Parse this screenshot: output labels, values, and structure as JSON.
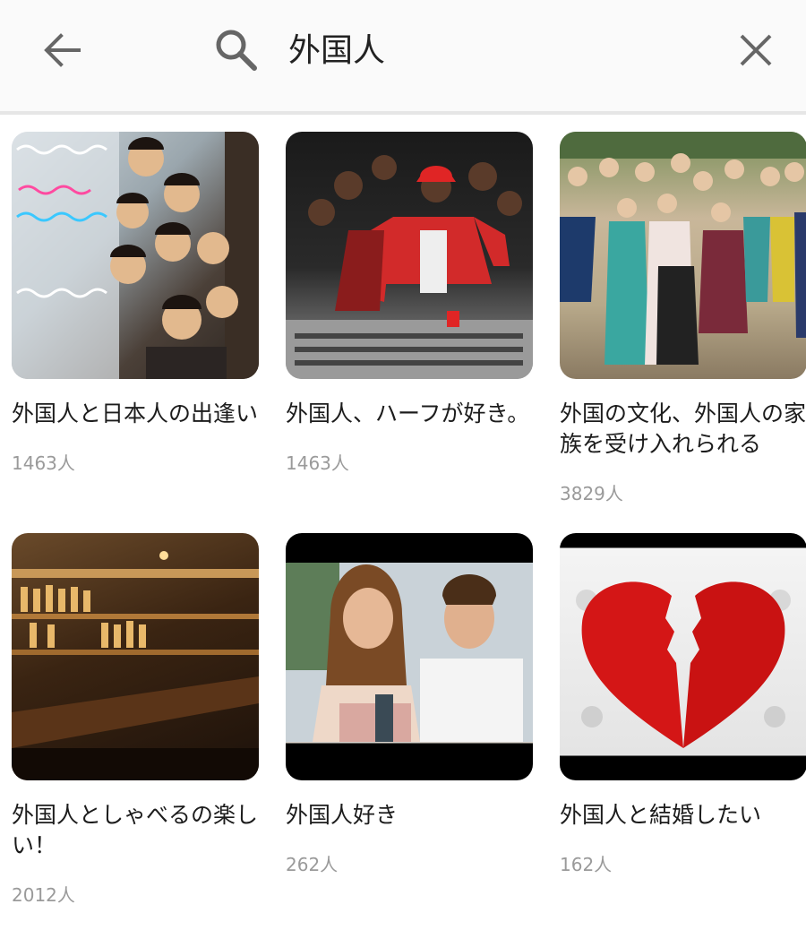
{
  "header": {
    "query": "外国人"
  },
  "results": [
    {
      "title": "外国人と日本人の出逢い",
      "count": "1463人",
      "image": "children-photo"
    },
    {
      "title": "外国人、ハーフが好き。",
      "count": "1463人",
      "image": "music-studio-photo"
    },
    {
      "title": "外国の文化、外国人の家族を受け入れられる",
      "count": "3829人",
      "image": "family-group-photo"
    },
    {
      "title": "外国人としゃべるの楽しい！",
      "count": "2012人",
      "image": "bar-photo"
    },
    {
      "title": "外国人好き",
      "count": "262人",
      "image": "couple-photo"
    },
    {
      "title": "外国人と結婚したい",
      "count": "162人",
      "image": "heart-photo"
    }
  ],
  "colors": {
    "text": "#1c1c1c",
    "muted": "#9a9a9a",
    "icon": "#666666",
    "divider": "#e6e6e6"
  }
}
